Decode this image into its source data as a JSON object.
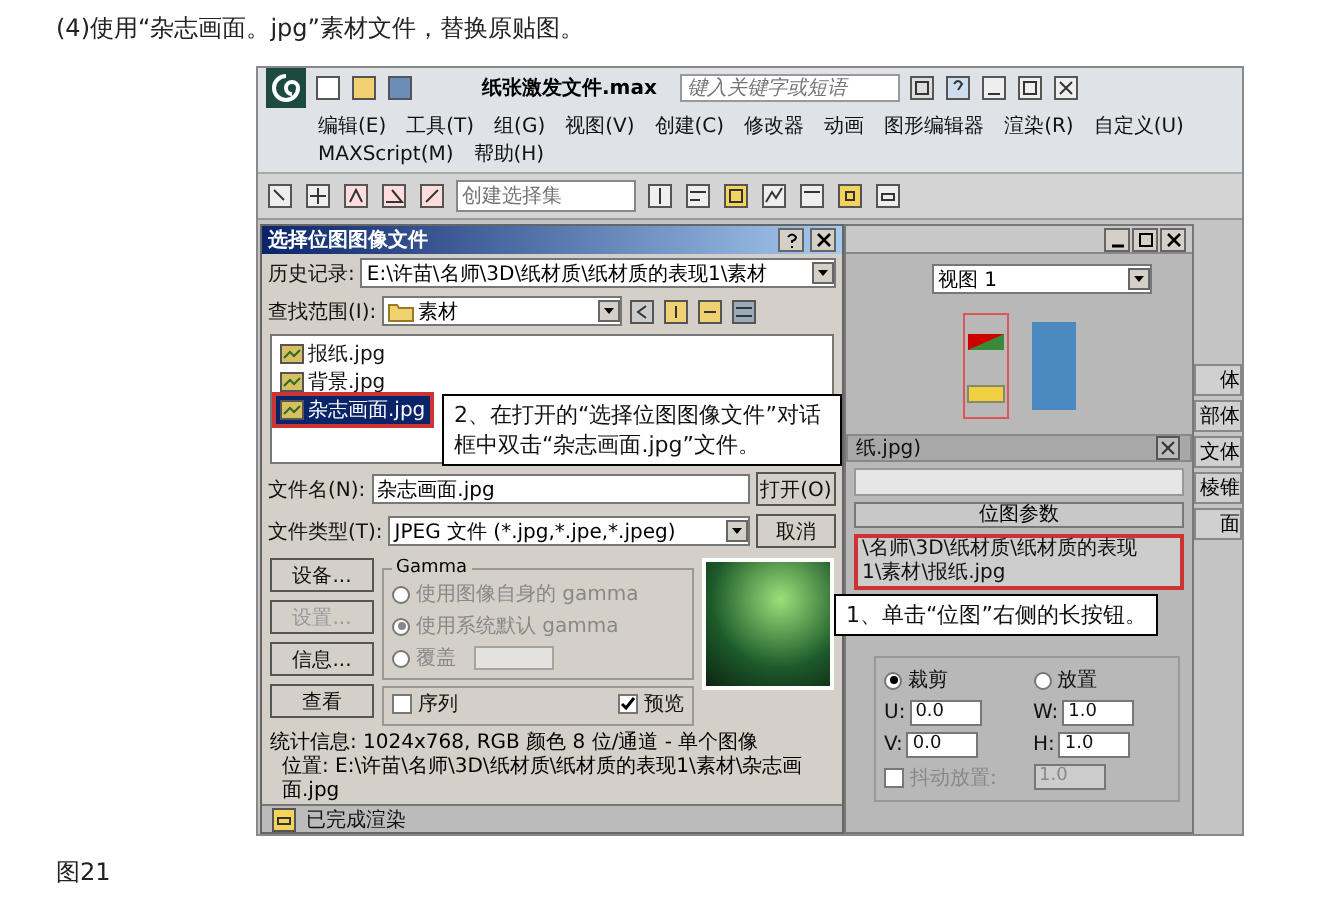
{
  "heading": "(4)使用“杂志画面。jpg”素材文件，替换原贴图。",
  "app": {
    "title": "纸张激发文件.max",
    "search": {
      "placeholder": "键入关键字或短语"
    },
    "menus": [
      "编辑(E)",
      "工具(T)",
      "组(G)",
      "视图(V)",
      "创建(C)",
      "修改器",
      "动画",
      "图形编辑器",
      "渲染(R)",
      "自定义(U)",
      "MAXScript(M)",
      "帮助(H)"
    ],
    "selection_set": {
      "placeholder": "创建选择集"
    },
    "command_panel": [
      "体",
      "部体",
      "文体",
      "棱锥",
      "面"
    ]
  },
  "file_dialog": {
    "title": "选择位图图像文件",
    "history_label": "历史记录:",
    "history": "E:\\许苗\\名师\\3D\\纸材质\\纸材质的表现1\\素材",
    "look_in_label": "查找范围(I):",
    "look_in": "素材",
    "files": [
      {
        "name": "报纸.jpg",
        "selected": false
      },
      {
        "name": "背景.jpg",
        "selected": false
      },
      {
        "name": "杂志画面.jpg",
        "selected": true
      }
    ],
    "file_name_label": "文件名(N):",
    "file_name": "杂志画面.jpg",
    "open_button": "打开(O)",
    "file_type_label": "文件类型(T):",
    "file_type": "JPEG 文件 (*.jpg,*.jpe,*.jpeg)",
    "cancel_button": "取消",
    "side_buttons": [
      {
        "label": "设备...",
        "disabled": false
      },
      {
        "label": "设置...",
        "disabled": true
      },
      {
        "label": "信息...",
        "disabled": false
      },
      {
        "label": "查看",
        "disabled": false
      }
    ],
    "gamma": {
      "title": "Gamma",
      "options": [
        {
          "label": "使用图像自身的 gamma",
          "selected": false
        },
        {
          "label": "使用系统默认 gamma",
          "selected": true
        },
        {
          "label": "覆盖",
          "selected": false
        }
      ],
      "disabled": true
    },
    "sequence": {
      "label": "序列",
      "checked": false
    },
    "preview": {
      "label": "预览",
      "checked": true
    },
    "stats": "统计信息: 1024x768, RGB 颜色 8 位/通道 - 单个图像",
    "location": "位置: E:\\许苗\\名师\\3D\\纸材质\\纸材质的表现1\\素材\\杂志画面.jpg"
  },
  "status_bar": "已完成渲染",
  "material_editor": {
    "viewport": "视图 1",
    "map_title": "纸.jpg)",
    "rollout": "位图参数",
    "bitmap_path": "\\名师\\3D\\纸材质\\纸材质的表现1\\素材\\报纸.jpg",
    "crop_modes": [
      {
        "label": "裁剪",
        "selected": true
      },
      {
        "label": "放置",
        "selected": false
      }
    ],
    "fields": [
      {
        "label": "U:",
        "value": "0.0"
      },
      {
        "label": "W:",
        "value": "1.0"
      },
      {
        "label": "V:",
        "value": "0.0"
      },
      {
        "label": "H:",
        "value": "1.0"
      }
    ],
    "jitter": {
      "label": "抖动放置:",
      "value": "1.0",
      "checked": false,
      "disabled": true
    }
  },
  "callouts": [
    {
      "text": "2、在打开的“选择位图图像文件”对话框中双击“杂志画面.jpg”文件。"
    },
    {
      "text": "1、单击“位图”右侧的长按钮。"
    }
  ],
  "figure_caption": "图21"
}
